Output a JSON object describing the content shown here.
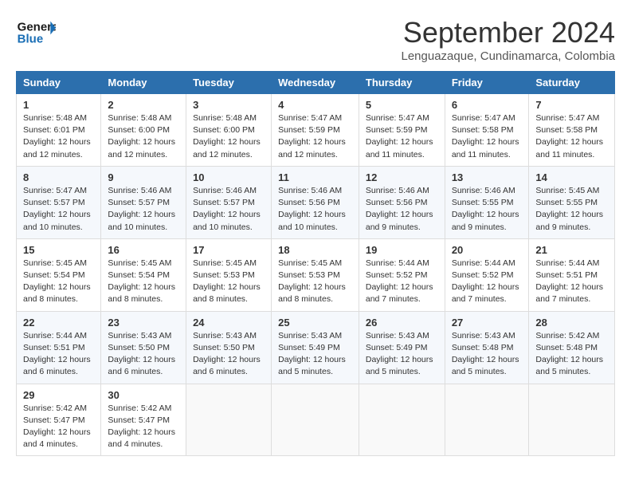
{
  "app": {
    "logo_line1": "General",
    "logo_line2": "Blue"
  },
  "header": {
    "month_title": "September 2024",
    "subtitle": "Lenguazaque, Cundinamarca, Colombia"
  },
  "columns": [
    "Sunday",
    "Monday",
    "Tuesday",
    "Wednesday",
    "Thursday",
    "Friday",
    "Saturday"
  ],
  "weeks": [
    [
      {
        "day": "1",
        "lines": [
          "Sunrise: 5:48 AM",
          "Sunset: 6:01 PM",
          "Daylight: 12 hours",
          "and 12 minutes."
        ]
      },
      {
        "day": "2",
        "lines": [
          "Sunrise: 5:48 AM",
          "Sunset: 6:00 PM",
          "Daylight: 12 hours",
          "and 12 minutes."
        ]
      },
      {
        "day": "3",
        "lines": [
          "Sunrise: 5:48 AM",
          "Sunset: 6:00 PM",
          "Daylight: 12 hours",
          "and 12 minutes."
        ]
      },
      {
        "day": "4",
        "lines": [
          "Sunrise: 5:47 AM",
          "Sunset: 5:59 PM",
          "Daylight: 12 hours",
          "and 12 minutes."
        ]
      },
      {
        "day": "5",
        "lines": [
          "Sunrise: 5:47 AM",
          "Sunset: 5:59 PM",
          "Daylight: 12 hours",
          "and 11 minutes."
        ]
      },
      {
        "day": "6",
        "lines": [
          "Sunrise: 5:47 AM",
          "Sunset: 5:58 PM",
          "Daylight: 12 hours",
          "and 11 minutes."
        ]
      },
      {
        "day": "7",
        "lines": [
          "Sunrise: 5:47 AM",
          "Sunset: 5:58 PM",
          "Daylight: 12 hours",
          "and 11 minutes."
        ]
      }
    ],
    [
      {
        "day": "8",
        "lines": [
          "Sunrise: 5:47 AM",
          "Sunset: 5:57 PM",
          "Daylight: 12 hours",
          "and 10 minutes."
        ]
      },
      {
        "day": "9",
        "lines": [
          "Sunrise: 5:46 AM",
          "Sunset: 5:57 PM",
          "Daylight: 12 hours",
          "and 10 minutes."
        ]
      },
      {
        "day": "10",
        "lines": [
          "Sunrise: 5:46 AM",
          "Sunset: 5:57 PM",
          "Daylight: 12 hours",
          "and 10 minutes."
        ]
      },
      {
        "day": "11",
        "lines": [
          "Sunrise: 5:46 AM",
          "Sunset: 5:56 PM",
          "Daylight: 12 hours",
          "and 10 minutes."
        ]
      },
      {
        "day": "12",
        "lines": [
          "Sunrise: 5:46 AM",
          "Sunset: 5:56 PM",
          "Daylight: 12 hours",
          "and 9 minutes."
        ]
      },
      {
        "day": "13",
        "lines": [
          "Sunrise: 5:46 AM",
          "Sunset: 5:55 PM",
          "Daylight: 12 hours",
          "and 9 minutes."
        ]
      },
      {
        "day": "14",
        "lines": [
          "Sunrise: 5:45 AM",
          "Sunset: 5:55 PM",
          "Daylight: 12 hours",
          "and 9 minutes."
        ]
      }
    ],
    [
      {
        "day": "15",
        "lines": [
          "Sunrise: 5:45 AM",
          "Sunset: 5:54 PM",
          "Daylight: 12 hours",
          "and 8 minutes."
        ]
      },
      {
        "day": "16",
        "lines": [
          "Sunrise: 5:45 AM",
          "Sunset: 5:54 PM",
          "Daylight: 12 hours",
          "and 8 minutes."
        ]
      },
      {
        "day": "17",
        "lines": [
          "Sunrise: 5:45 AM",
          "Sunset: 5:53 PM",
          "Daylight: 12 hours",
          "and 8 minutes."
        ]
      },
      {
        "day": "18",
        "lines": [
          "Sunrise: 5:45 AM",
          "Sunset: 5:53 PM",
          "Daylight: 12 hours",
          "and 8 minutes."
        ]
      },
      {
        "day": "19",
        "lines": [
          "Sunrise: 5:44 AM",
          "Sunset: 5:52 PM",
          "Daylight: 12 hours",
          "and 7 minutes."
        ]
      },
      {
        "day": "20",
        "lines": [
          "Sunrise: 5:44 AM",
          "Sunset: 5:52 PM",
          "Daylight: 12 hours",
          "and 7 minutes."
        ]
      },
      {
        "day": "21",
        "lines": [
          "Sunrise: 5:44 AM",
          "Sunset: 5:51 PM",
          "Daylight: 12 hours",
          "and 7 minutes."
        ]
      }
    ],
    [
      {
        "day": "22",
        "lines": [
          "Sunrise: 5:44 AM",
          "Sunset: 5:51 PM",
          "Daylight: 12 hours",
          "and 6 minutes."
        ]
      },
      {
        "day": "23",
        "lines": [
          "Sunrise: 5:43 AM",
          "Sunset: 5:50 PM",
          "Daylight: 12 hours",
          "and 6 minutes."
        ]
      },
      {
        "day": "24",
        "lines": [
          "Sunrise: 5:43 AM",
          "Sunset: 5:50 PM",
          "Daylight: 12 hours",
          "and 6 minutes."
        ]
      },
      {
        "day": "25",
        "lines": [
          "Sunrise: 5:43 AM",
          "Sunset: 5:49 PM",
          "Daylight: 12 hours",
          "and 5 minutes."
        ]
      },
      {
        "day": "26",
        "lines": [
          "Sunrise: 5:43 AM",
          "Sunset: 5:49 PM",
          "Daylight: 12 hours",
          "and 5 minutes."
        ]
      },
      {
        "day": "27",
        "lines": [
          "Sunrise: 5:43 AM",
          "Sunset: 5:48 PM",
          "Daylight: 12 hours",
          "and 5 minutes."
        ]
      },
      {
        "day": "28",
        "lines": [
          "Sunrise: 5:42 AM",
          "Sunset: 5:48 PM",
          "Daylight: 12 hours",
          "and 5 minutes."
        ]
      }
    ],
    [
      {
        "day": "29",
        "lines": [
          "Sunrise: 5:42 AM",
          "Sunset: 5:47 PM",
          "Daylight: 12 hours",
          "and 4 minutes."
        ]
      },
      {
        "day": "30",
        "lines": [
          "Sunrise: 5:42 AM",
          "Sunset: 5:47 PM",
          "Daylight: 12 hours",
          "and 4 minutes."
        ]
      },
      null,
      null,
      null,
      null,
      null
    ]
  ]
}
